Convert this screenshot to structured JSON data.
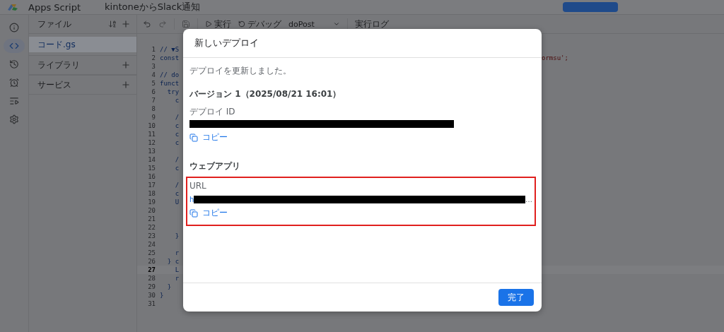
{
  "header": {
    "app_name": "Apps Script",
    "project_title": "kintoneからSlack通知"
  },
  "rail": [
    {
      "selected": false
    },
    {
      "selected": true
    },
    {
      "selected": false
    },
    {
      "selected": false
    },
    {
      "selected": false
    },
    {
      "selected": false
    }
  ],
  "files_panel": {
    "title": "ファイル",
    "files": [
      {
        "name": "コード.gs",
        "selected": true
      }
    ],
    "sections": [
      {
        "title": "ライブラリ"
      },
      {
        "title": "サービス"
      }
    ]
  },
  "toolbar": {
    "run": "実行",
    "debug": "デバッグ",
    "function": "doPost",
    "log": "実行ログ"
  },
  "code_lines": [
    {
      "number": "1",
      "text": "// ▼S",
      "current": false
    },
    {
      "number": "2",
      "text": "const",
      "tail": "ormsu';",
      "current": false
    },
    {
      "number": "3",
      "current": false
    },
    {
      "number": "4",
      "text": "// do",
      "current": false
    },
    {
      "number": "5",
      "text": "funct",
      "current": false
    },
    {
      "number": "6",
      "text": "  try",
      "current": false
    },
    {
      "number": "7",
      "text": "    c",
      "current": false
    },
    {
      "number": "8",
      "current": false
    },
    {
      "number": "9",
      "text": "    /",
      "current": false
    },
    {
      "number": "10",
      "text": "    c",
      "current": false
    },
    {
      "number": "11",
      "text": "    c",
      "current": false
    },
    {
      "number": "12",
      "text": "    c",
      "current": false
    },
    {
      "number": "13",
      "current": false
    },
    {
      "number": "14",
      "text": "    /",
      "current": false
    },
    {
      "number": "15",
      "text": "    c",
      "current": false
    },
    {
      "number": "16",
      "current": false
    },
    {
      "number": "17",
      "text": "    /",
      "current": false
    },
    {
      "number": "18",
      "text": "    c",
      "current": false
    },
    {
      "number": "19",
      "text": "    U",
      "current": false
    },
    {
      "number": "20",
      "current": false
    },
    {
      "number": "21",
      "current": false
    },
    {
      "number": "22",
      "current": false
    },
    {
      "number": "23",
      "text": "    }",
      "current": false
    },
    {
      "number": "24",
      "current": false
    },
    {
      "number": "25",
      "text": "    r",
      "current": false
    },
    {
      "number": "26",
      "text": "  } c",
      "current": false
    },
    {
      "number": "27",
      "text": "    L",
      "current": true
    },
    {
      "number": "28",
      "text": "    r",
      "current": false
    },
    {
      "number": "29",
      "text": "  }",
      "current": false
    },
    {
      "number": "30",
      "text": "}",
      "current": false
    },
    {
      "number": "31",
      "current": false
    }
  ],
  "dialog": {
    "title": "新しいデプロイ",
    "message": "デプロイを更新しました。",
    "version": "バージョン 1（2025/08/21 16:01）",
    "deploy_id": {
      "label": "デプロイ ID",
      "copy": "コピー"
    },
    "web_app": {
      "title": "ウェブアプリ",
      "label": "URL",
      "url_start": "h",
      "url_end": "…",
      "copy": "コピー",
      "highlighted": true
    },
    "done_button": "完了"
  }
}
